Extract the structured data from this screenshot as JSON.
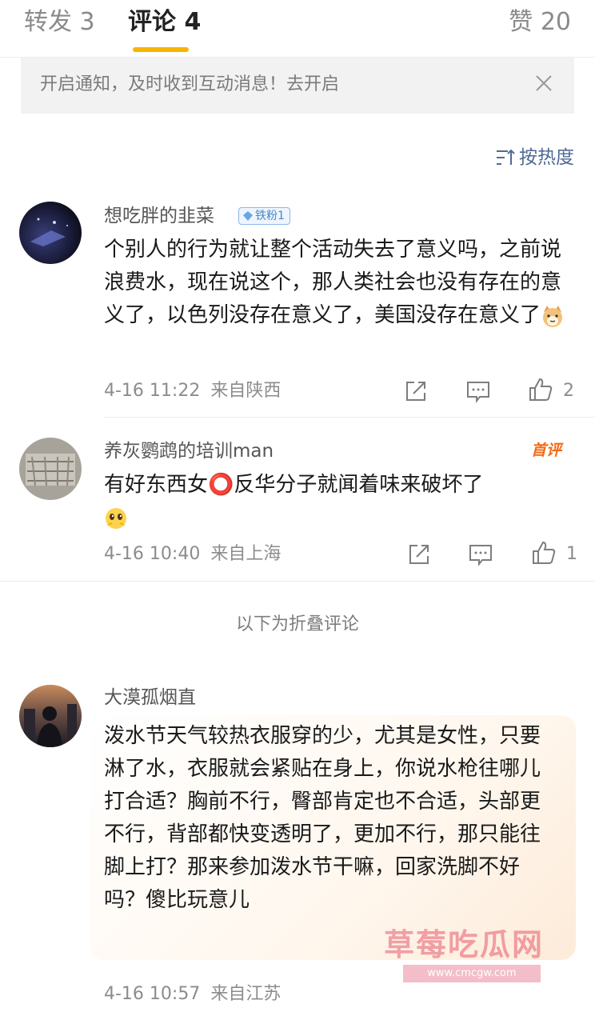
{
  "tabs": [
    {
      "label": "转发 3"
    },
    {
      "label": "评论 4"
    },
    {
      "label": "赞 20"
    }
  ],
  "notice": {
    "text": "开启通知，及时收到互动消息！去开启"
  },
  "sort": {
    "label": "按热度"
  },
  "comments": [
    {
      "username": "想吃胖的韭菜",
      "badge": "铁粉1",
      "text": "个别人的行为就让整个活动失去了意义吗，之前说浪费水，现在说这个，那人类社会也没有存在的意义了，以色列没存在意义了，美国没存在意义了",
      "time": "4-16 11:22",
      "location": "来自陕西",
      "likes": "2"
    },
    {
      "username": "养灰鹦鹉的培训man",
      "badge": "首评",
      "text": "有好东西女⭕反华分子就闻着味来破坏了",
      "time": "4-16 10:40",
      "location": "来自上海",
      "likes": "1"
    }
  ],
  "folded_label": "以下为折叠评论",
  "folded_comment": {
    "username": "大漠孤烟直",
    "text": "泼水节天气较热衣服穿的少，尤其是女性，只要淋了水，衣服就会紧贴在身上，你说水枪往哪儿打合适？胸前不行，臀部肯定也不合适，头部更不行，背部都快变透明了，更加不行，那只能往脚上打？那来参加泼水节干嘛，回家洗脚不好吗？傻比玩意儿",
    "time": "4-16 10:57",
    "location": "来自江苏"
  },
  "watermark": {
    "text": "草莓吃瓜网",
    "url": "www.cmcgw.com"
  },
  "colors": {
    "accent": "#f7b500",
    "link": "#506a94",
    "first_badge": "#f26b17"
  }
}
